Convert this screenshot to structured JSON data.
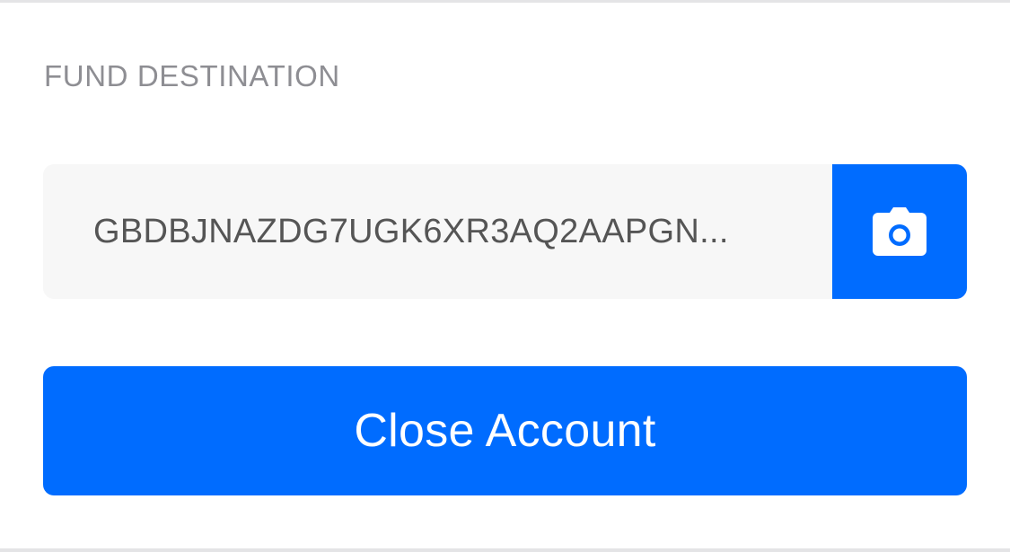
{
  "section": {
    "label": "FUND DESTINATION"
  },
  "destination": {
    "address_display": "GBDBJNAZDG7UGK6XR3AQ2AAPGN...",
    "scan_icon": "camera-icon"
  },
  "actions": {
    "close_account_label": "Close Account"
  },
  "colors": {
    "accent": "#006cff",
    "field_background": "#f7f7f7",
    "label_text": "#8e8e93",
    "value_text": "#555555"
  }
}
